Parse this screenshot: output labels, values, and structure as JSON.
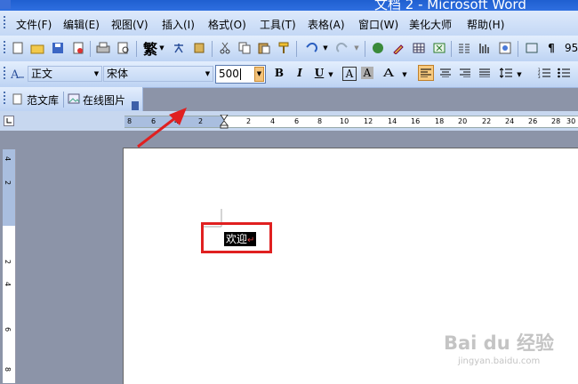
{
  "window": {
    "title": "文档 2 - Microsoft Word"
  },
  "menu": {
    "items": [
      "文件(F)",
      "编辑(E)",
      "视图(V)",
      "插入(I)",
      "格式(O)",
      "工具(T)",
      "表格(A)",
      "窗口(W)",
      "美化大师",
      "帮助(H)"
    ]
  },
  "standard_toolbar": {
    "traditional_char": "繁",
    "zoom": "95"
  },
  "format_toolbar": {
    "style_value": "正文",
    "font_value": "宋体",
    "size_value": "500",
    "bold": "B",
    "italic": "I",
    "underline": "U",
    "char_border": "A",
    "char_shading": "A",
    "char_scale": "A"
  },
  "extra_toolbar": {
    "item1": "范文库",
    "item2": "在线图片"
  },
  "ruler": {
    "h_labels": [
      "8",
      "6",
      "4",
      "2",
      "2",
      "4",
      "6",
      "8",
      "10",
      "12",
      "14",
      "16",
      "18",
      "20",
      "22",
      "24",
      "26",
      "28",
      "30"
    ],
    "v_labels": [
      "4",
      "2",
      "2",
      "4",
      "6",
      "8"
    ]
  },
  "document": {
    "selected_text": "欢迎",
    "paragraph_mark": "↵"
  },
  "watermark": {
    "brand": "Bai du 经验",
    "url": "jingyan.baidu.com"
  },
  "colors": {
    "highlight_box": "#e02020",
    "arrow": "#e02020",
    "selection_bg": "#000000"
  }
}
